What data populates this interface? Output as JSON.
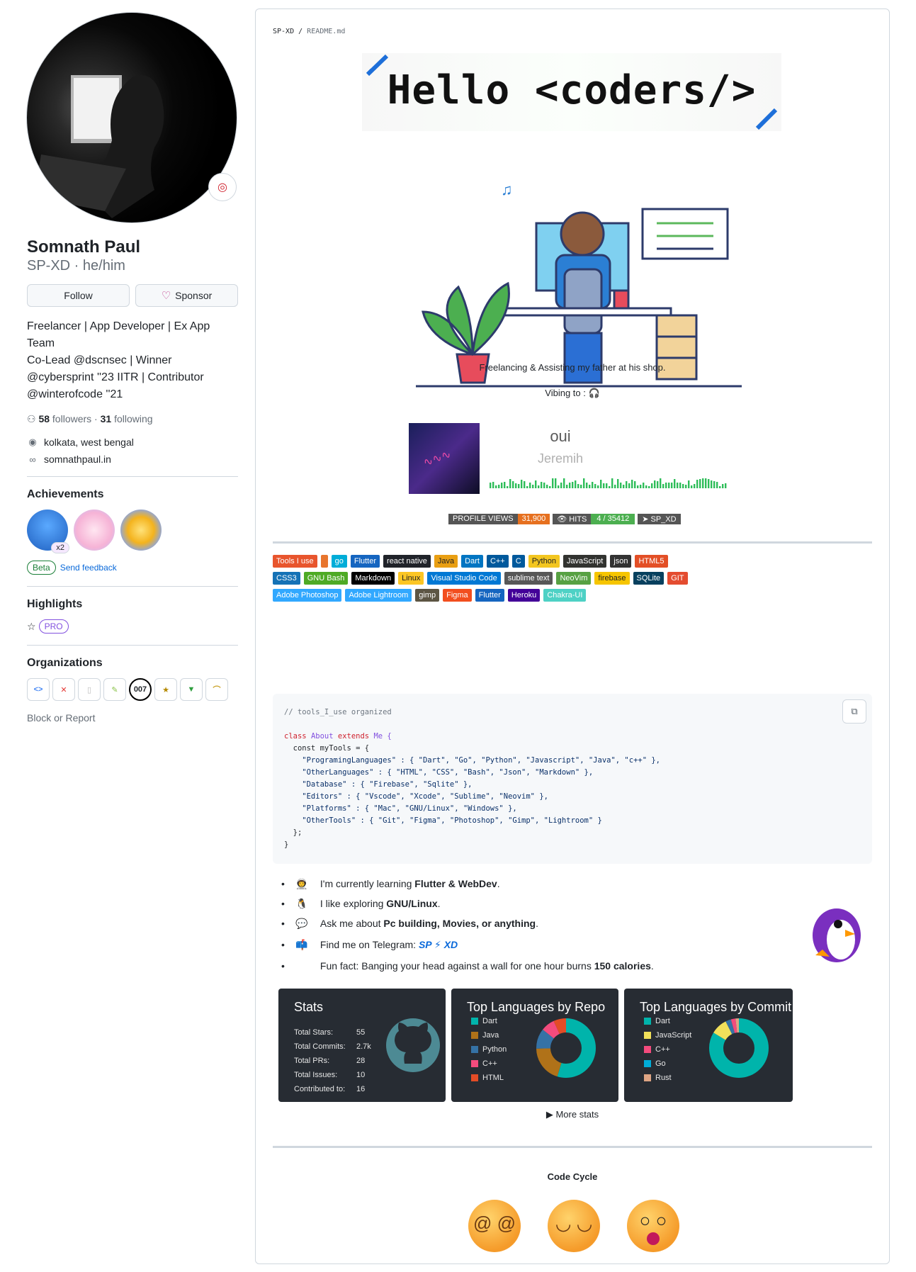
{
  "profile": {
    "name": "Somnath Paul",
    "login": "SP-XD · he/him",
    "follow": "Follow",
    "sponsor": "Sponsor",
    "bio_lines": [
      "Freelancer | App Developer | Ex App Team",
      "Co-Lead @dscnsec | Winner",
      "@cybersprint ''23 IITR | Contributor",
      "@winterofcode ''21"
    ],
    "followers": "58",
    "followers_label": "followers",
    "following": "31",
    "following_label": "following",
    "location": "kolkata, west bengal",
    "website": "somnathpaul.in",
    "achievements_title": "Achievements",
    "ach_count": "x2",
    "beta": "Beta",
    "send_feedback": "Send feedback",
    "highlights_title": "Highlights",
    "pro": "PRO",
    "orgs_title": "Organizations",
    "block": "Block or Report",
    "org_007": "007"
  },
  "readme": {
    "path_owner": "SP-XD",
    "path_file": "README.md",
    "banner": "Hello <coders/>",
    "freelancing": "Freelancing & Assisting my father at his shop.",
    "vibing": "Vibing to :",
    "song_title": "oui",
    "song_artist": "Jeremih",
    "views_label": "PROFILE VIEWS",
    "views_value": "31,900",
    "hits_label": "HITS",
    "hits_value": "4 / 35412",
    "tg_label": "SP_XD"
  },
  "badges_row1": [
    {
      "t": "Tools I use",
      "c": "#e8552d"
    },
    {
      "t": "",
      "c": "#e8752d"
    },
    {
      "t": "go",
      "c": "#00add8"
    },
    {
      "t": "Flutter",
      "c": "#1565c0"
    },
    {
      "t": "react native",
      "c": "#20232a"
    },
    {
      "t": "Java",
      "c": "#e99f13"
    },
    {
      "t": "Dart",
      "c": "#0175c2"
    },
    {
      "t": "C++",
      "c": "#00599c"
    },
    {
      "t": "C",
      "c": "#00599c"
    },
    {
      "t": "Python",
      "c": "#f3c620"
    },
    {
      "t": "JavaScript",
      "c": "#323330"
    },
    {
      "t": "json",
      "c": "#333333"
    },
    {
      "t": "HTML5",
      "c": "#e34f26"
    }
  ],
  "badges_row2": [
    {
      "t": "CSS3",
      "c": "#1572b6"
    },
    {
      "t": "GNU Bash",
      "c": "#4eaa25"
    },
    {
      "t": "Markdown",
      "c": "#000000"
    },
    {
      "t": "Linux",
      "c": "#fcc624"
    },
    {
      "t": "Visual Studio Code",
      "c": "#0078d4"
    },
    {
      "t": "sublime text",
      "c": "#575757"
    },
    {
      "t": "NeoVim",
      "c": "#57a143"
    },
    {
      "t": "firebase",
      "c": "#f6c500"
    },
    {
      "t": "SQLite",
      "c": "#07405e"
    },
    {
      "t": "GIT",
      "c": "#e44c30"
    }
  ],
  "badges_row3": [
    {
      "t": "Adobe Photoshop",
      "c": "#31a8ff"
    },
    {
      "t": "Adobe Lightroom",
      "c": "#31a8ff"
    },
    {
      "t": "gimp",
      "c": "#5c5543"
    },
    {
      "t": "Figma",
      "c": "#f24e1e"
    },
    {
      "t": "Flutter",
      "c": "#1565c0"
    },
    {
      "t": "Heroku",
      "c": "#430098"
    },
    {
      "t": "Chakra-UI",
      "c": "#4ed1c5"
    }
  ],
  "code": {
    "comment": "// tools_I_use organized",
    "lines": [
      "  const myTools = {",
      "    \"ProgramingLanguages\" : { \"Dart\", \"Go\", \"Python\", \"Javascript\", \"Java\", \"c++\" },",
      "    \"OtherLanguages\" : { \"HTML\", \"CSS\", \"Bash\", \"Json\", \"Markdown\" },",
      "    \"Database\" : { \"Firebase\", \"Sqlite\" },",
      "    \"Editors\" : { \"Vscode\", \"Xcode\", \"Sublime\", \"Neovim\" },",
      "    \"Platforms\" : { \"Mac\", \"GNU/Linux\", \"Windows\" },",
      "    \"OtherTools\" : { \"Git\", \"Figma\", \"Photoshop\", \"Gimp\", \"Lightroom\" }",
      "  };"
    ],
    "class_kw": "class",
    "class_name": "About",
    "extends_kw": "extends",
    "parent": "Me {",
    "close": "}"
  },
  "facts": {
    "f1a": "I'm currently learning",
    "f1b": "Flutter & WebDev",
    "f2a": "I like exploring",
    "f2b": "GNU/Linux",
    "f3a": "Ask me about",
    "f3b": "Pc building, Movies, or anything",
    "f4a": "Find me on Telegram:",
    "f4b": "SP ⚡ XD",
    "f5a": "Fun fact: Banging your head against a wall for one hour burns",
    "f5b": "150 calories"
  },
  "stats": {
    "title": "Stats",
    "rows": [
      {
        "l": "Total Stars:",
        "v": "55"
      },
      {
        "l": "Total Commits:",
        "v": "2.7k"
      },
      {
        "l": "Total PRs:",
        "v": "28"
      },
      {
        "l": "Total Issues:",
        "v": "10"
      },
      {
        "l": "Contributed to:",
        "v": "16"
      }
    ]
  },
  "langs_repo": {
    "title": "Top Languages by Repo",
    "items": [
      {
        "n": "Dart",
        "c": "#00b4ab"
      },
      {
        "n": "Java",
        "c": "#b07219"
      },
      {
        "n": "Python",
        "c": "#3572a5"
      },
      {
        "n": "C++",
        "c": "#f34b7d"
      },
      {
        "n": "HTML",
        "c": "#e34c26"
      }
    ]
  },
  "langs_commit": {
    "title": "Top Languages by Commit",
    "items": [
      {
        "n": "Dart",
        "c": "#00b4ab"
      },
      {
        "n": "JavaScript",
        "c": "#f1e05a"
      },
      {
        "n": "C++",
        "c": "#f34b7d"
      },
      {
        "n": "Go",
        "c": "#00add8"
      },
      {
        "n": "Rust",
        "c": "#dea584"
      }
    ]
  },
  "more_stats": "More stats",
  "code_cycle": "Code Cycle"
}
